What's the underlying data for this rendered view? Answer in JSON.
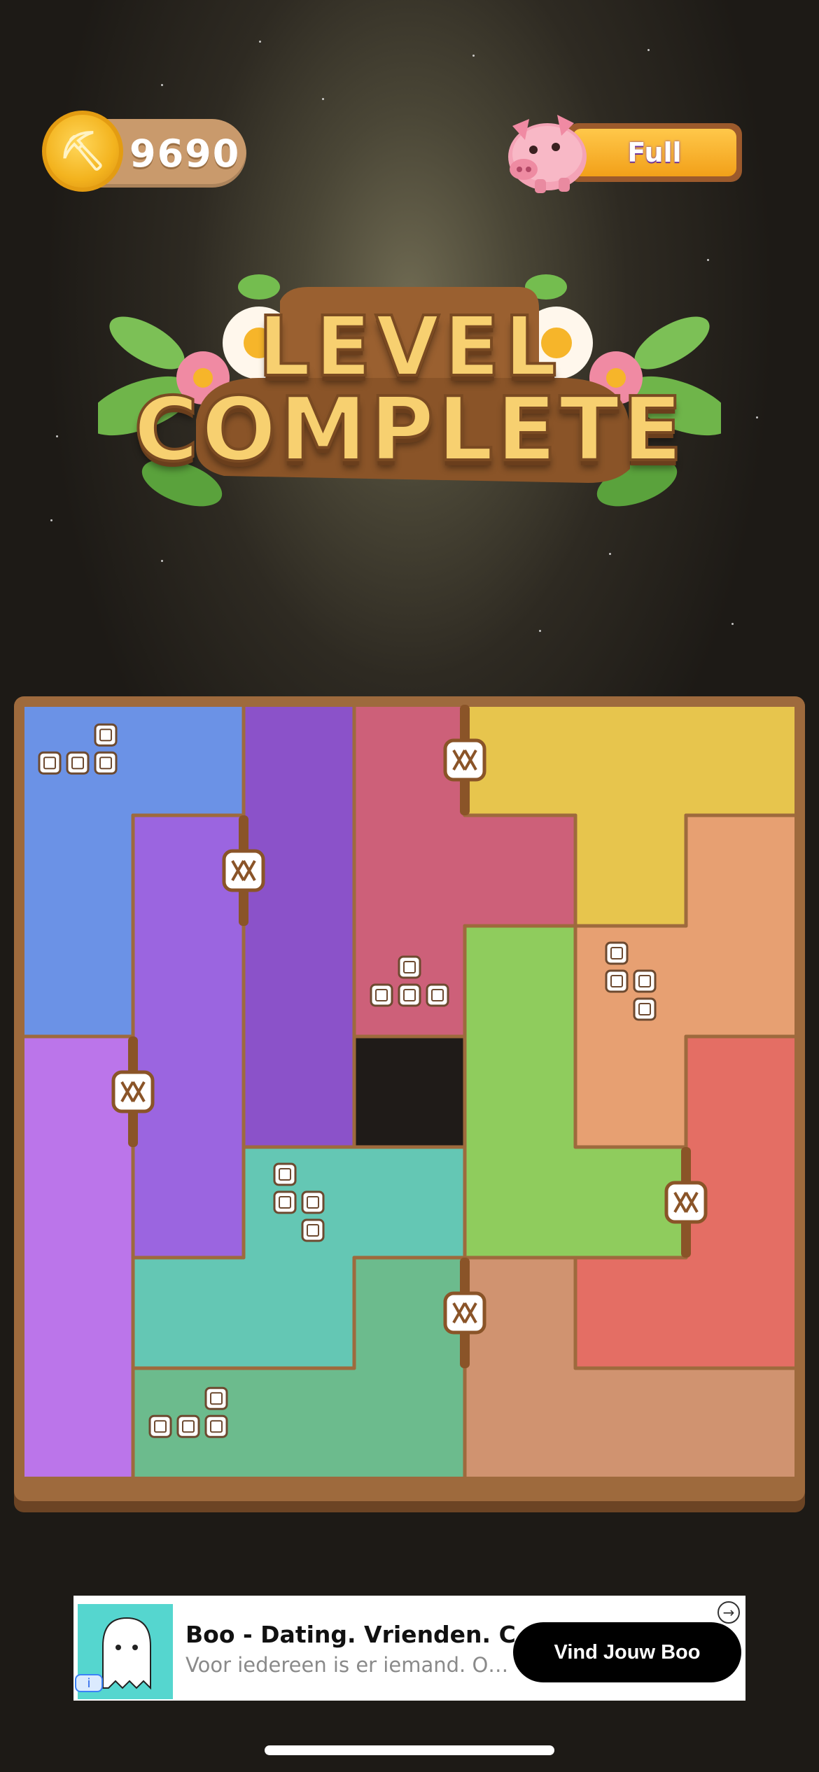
{
  "hud": {
    "coins": "9690",
    "piggy_status": "Full"
  },
  "banner": {
    "line1": "LEVEL",
    "line2": "COMPLETE"
  },
  "board_colors": {
    "blue": "#6b92e6",
    "violet": "#9b65e0",
    "purple": "#8b52c9",
    "pink": "#cd6079",
    "yellow": "#e7c54d",
    "orange": "#e7a072",
    "green": "#8fcc5d",
    "teal": "#64c7b4",
    "lilac": "#bb75ea",
    "red": "#e46e64",
    "brown": "#d09370",
    "seagreen": "#6cbb8d",
    "wall": "#9e6a3d"
  },
  "ad": {
    "title": "Boo - Dating. Vrienden. C…",
    "subtitle": "Voor iedereen is er iemand. O…",
    "cta": "Vind Jouw Boo",
    "info": "i",
    "close": "→"
  }
}
